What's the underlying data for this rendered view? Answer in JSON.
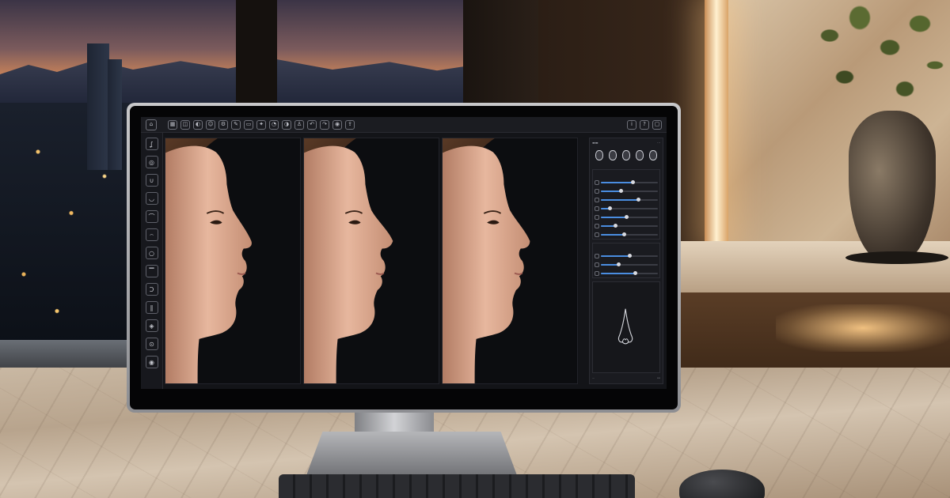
{
  "app": {
    "toolbar_icons": [
      "home-icon",
      "grid-icon",
      "layers-icon",
      "mirror-icon",
      "face-icon",
      "settings-icon",
      "pen-icon",
      "ruler-icon",
      "wand-icon",
      "profile-icon",
      "compare-icon",
      "user-icon",
      "undo-icon",
      "redo-icon",
      "camera-icon",
      "share-icon"
    ],
    "toolbar_right_icons": [
      "info-icon",
      "help-icon",
      "window-icon"
    ],
    "sidebar_icons": [
      "nose-icon",
      "eye-icon",
      "chin-icon",
      "lip-icon",
      "jaw-icon",
      "brow-icon",
      "cheek-icon",
      "forehead-icon",
      "ear-icon",
      "neck-icon",
      "skin-icon",
      "pin-icon",
      "camera-icon"
    ],
    "viewports": [
      {
        "name": "before-view"
      },
      {
        "name": "simulation-view"
      },
      {
        "name": "after-view"
      }
    ],
    "panel": {
      "presets": [
        {
          "icon": "face-preset-icon"
        },
        {
          "icon": "face-preset-icon"
        },
        {
          "icon": "face-preset-icon"
        },
        {
          "icon": "face-preset-icon"
        },
        {
          "icon": "face-preset-icon"
        }
      ],
      "group1_sliders": [
        {
          "level": 0.55
        },
        {
          "level": 0.35
        },
        {
          "level": 0.65
        },
        {
          "level": 0.15
        },
        {
          "level": 0.45
        },
        {
          "level": 0.25
        },
        {
          "level": 0.4
        }
      ],
      "group2_sliders": [
        {
          "level": 0.5
        },
        {
          "level": 0.3
        },
        {
          "level": 0.6
        }
      ]
    },
    "colors": {
      "accent": "#4a8de0",
      "ui_background": "#131418"
    }
  }
}
